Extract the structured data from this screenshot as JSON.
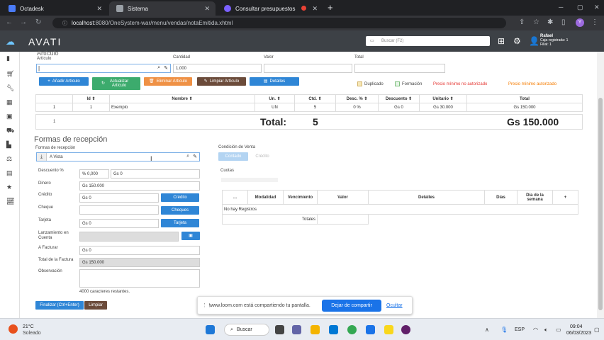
{
  "browser": {
    "tabs": [
      {
        "label": "Octadesk",
        "color": "#4a7bf7"
      },
      {
        "label": "Sistema",
        "color": "#9aa0a6"
      },
      {
        "label": "Consultar presupuestos",
        "color": "#7b61ff"
      }
    ],
    "url_host": "localhost",
    "url_path": ":8080/OneSystem-war/menu/vendas/notaEmitida.xhtml"
  },
  "app": {
    "logo": "AVATI",
    "search_placeholder": "Buscar (F2)",
    "user_name": "Rafael",
    "user_line1": "Caja registrada: 1",
    "user_line2": "Filial: 1"
  },
  "articulo": {
    "section_title": "Artículo",
    "label_articulo": "Artículo",
    "label_cantidad": "Cantidad",
    "label_valor": "Valor",
    "label_total": "Total",
    "articulo_value": "",
    "cantidad_value": "1,000",
    "btn_anadir": "Añadir Artículo",
    "btn_actualizar": "Actualizar Artículo",
    "btn_eliminar": "Eliminar Artículo",
    "btn_limpiar": "Limpiar Artículo",
    "btn_detalles": "Detalles",
    "chk_duplicado": "Duplicado",
    "chk_formacion": "Formación",
    "warn1": "Precio mínimo no autorizado",
    "warn2": "Precio mínimo autorizado"
  },
  "items_table": {
    "headers": [
      "Id ⇕",
      "Nombre ⇕",
      "Un. ⇕",
      "Ctd. ⇕",
      "Desc. % ⇕",
      "Descuento ⇕",
      "Unitario ⇕",
      "Total"
    ],
    "rows": [
      [
        "1",
        "1",
        "Exemplo",
        "UN",
        "5",
        "0 %",
        "Gs 0",
        "Gs 30.000",
        "Gs 150.000"
      ]
    ],
    "footer_index": "1",
    "total_label": "Total:",
    "total_qty": "5",
    "total_value": "Gs 150.000"
  },
  "recepcion": {
    "title": "Formas de recepción",
    "label_formas": "Formas de recepción",
    "forma_value": "A Vista",
    "label_descuento": "Descuento %",
    "descuento_pct": "% 0,000",
    "descuento_gs": "Gs 0",
    "label_dinero": "Dinero",
    "dinero": "Gs 150.000",
    "label_credito": "Crédito",
    "credito": "Gs 0",
    "btn_credito": "Crédito",
    "label_cheque": "Cheque",
    "cheque": "",
    "btn_cheques": "Cheques",
    "label_tarjeta": "Tarjeta",
    "tarjeta": "Gs 0",
    "btn_tarjeta": "Tarjeta",
    "label_lanzamiento": "Lanzamiento en Cuenta",
    "label_afacturar": "A Facturar",
    "afacturar": "Gs 0",
    "label_totalfactura": "Total de la Factura",
    "totalfactura": "Gs 150.000",
    "label_observacion": "Observación",
    "chars_left": "4000 caracteres restantes.",
    "btn_finalizar": "Finalizar (Ctrl+Enter)",
    "btn_limpiar": "Limpiar"
  },
  "venta": {
    "label_condicion": "Condición de Venta",
    "btn_contado": "Contado",
    "btn_credito": "Crédito",
    "label_cuotas": "Cuotas",
    "headers": [
      "...",
      "Modalidad",
      "Vencimiento",
      "Valor",
      "Detalles",
      "Días",
      "Día de la semana",
      "+"
    ],
    "empty": "No hay Registros",
    "totales": "Totales"
  },
  "share": {
    "text": "www.loom.com está compartiendo tu pantalla.",
    "btn_stop": "Dejar de compartir",
    "btn_hide": "Ocultar"
  },
  "taskbar": {
    "temp": "21°C",
    "weather": "Soleado",
    "search": "Buscar",
    "lang": "ESP",
    "time": "09:04",
    "date": "06/03/2023"
  }
}
